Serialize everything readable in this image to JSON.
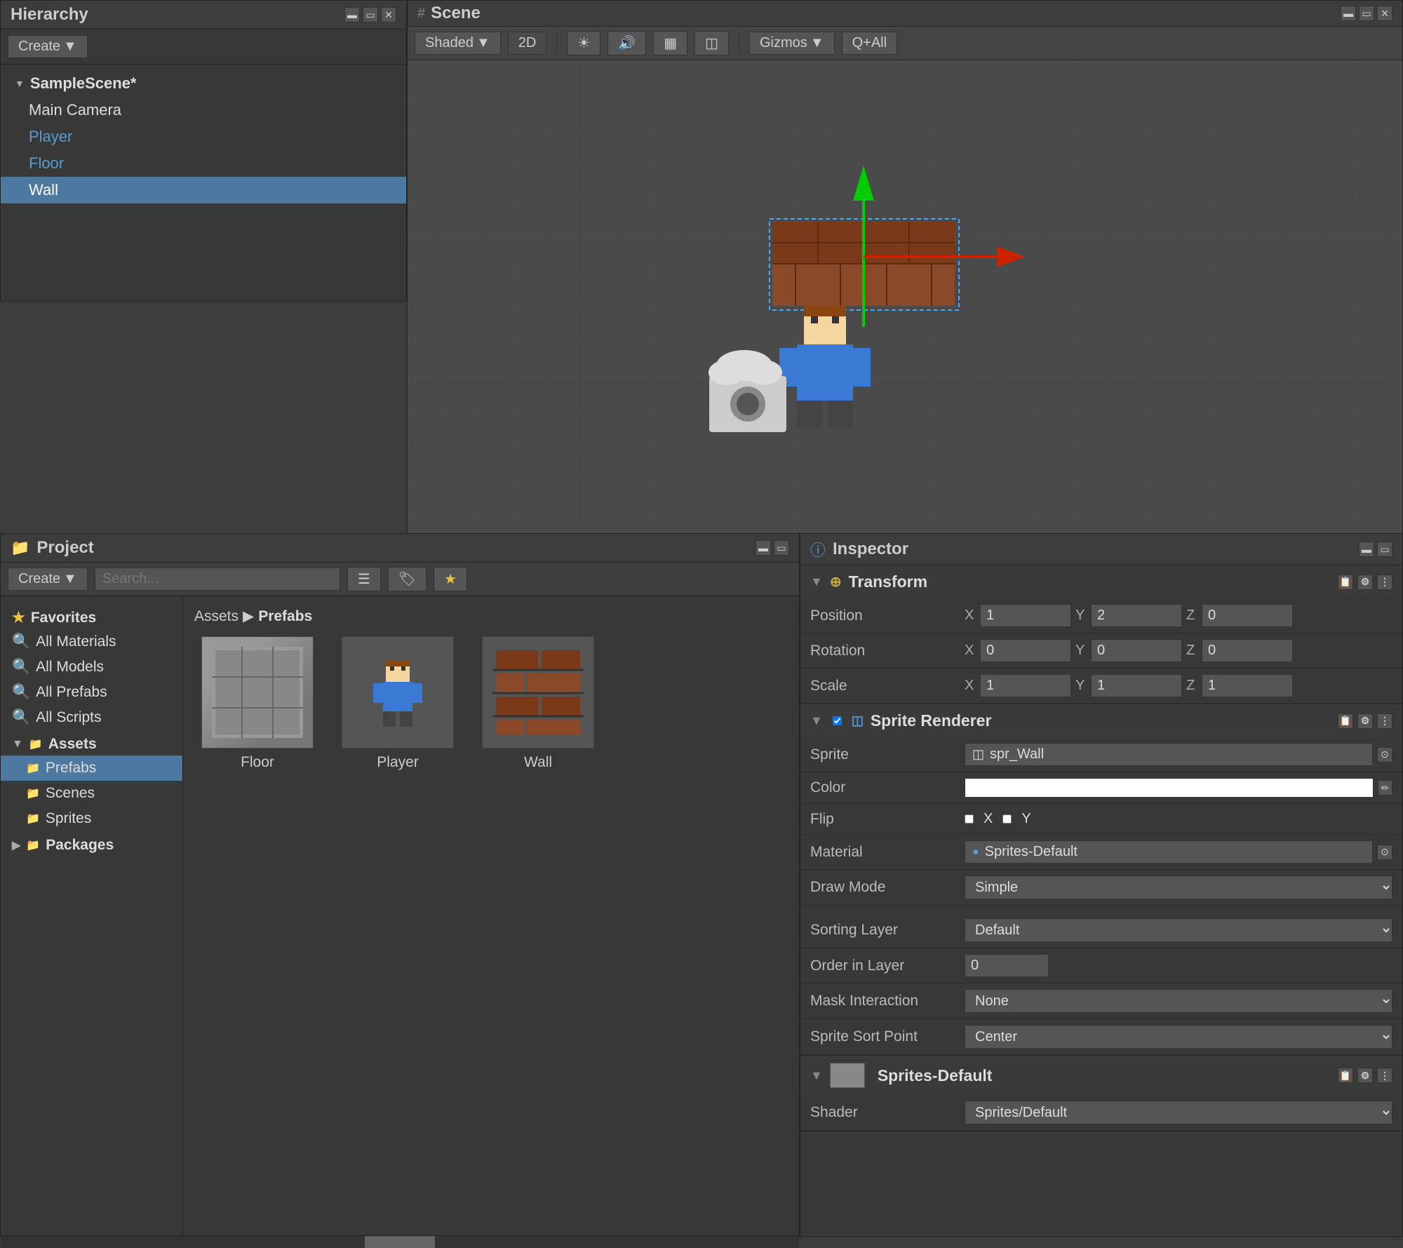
{
  "hierarchy": {
    "title": "Hierarchy",
    "create_label": "Create",
    "scene_name": "SampleScene*",
    "items": [
      {
        "label": "Main Camera",
        "indent": 1,
        "color": "white",
        "selected": false
      },
      {
        "label": "Player",
        "indent": 1,
        "color": "blue",
        "selected": false
      },
      {
        "label": "Floor",
        "indent": 1,
        "color": "blue",
        "selected": false
      },
      {
        "label": "Wall",
        "indent": 1,
        "color": "white",
        "selected": true
      }
    ]
  },
  "scene": {
    "title": "Scene",
    "shading_mode": "Shaded",
    "is_2d": true,
    "toolbar_items": [
      "Shaded",
      "2D",
      "☀",
      "🔊",
      "📷",
      "📊",
      "Gizmos",
      "Q+All"
    ]
  },
  "project": {
    "title": "Project",
    "create_label": "Create",
    "search_placeholder": "",
    "breadcrumb_path": "Assets",
    "breadcrumb_bold": "Prefabs",
    "sidebar": {
      "favorites_label": "Favorites",
      "items": [
        "All Materials",
        "All Models",
        "All Prefabs",
        "All Scripts"
      ],
      "assets_label": "Assets",
      "asset_folders": [
        "Prefabs",
        "Scenes",
        "Sprites"
      ],
      "packages_label": "Packages"
    },
    "assets": [
      {
        "name": "Floor",
        "type": "floor"
      },
      {
        "name": "Player",
        "type": "player"
      },
      {
        "name": "Wall",
        "type": "wall"
      }
    ]
  },
  "inspector": {
    "title": "Inspector",
    "transform": {
      "label": "Transform",
      "position": {
        "label": "Position",
        "x": "1",
        "y": "2",
        "z": "0"
      },
      "rotation": {
        "label": "Rotation",
        "x": "0",
        "y": "0",
        "z": "0"
      },
      "scale": {
        "label": "Scale",
        "x": "1",
        "y": "1",
        "z": "1"
      }
    },
    "sprite_renderer": {
      "label": "Sprite Renderer",
      "sprite_label": "Sprite",
      "sprite_value": "spr_Wall",
      "color_label": "Color",
      "flip_label": "Flip",
      "flip_x": "X",
      "flip_y": "Y",
      "material_label": "Material",
      "material_value": "Sprites-Default",
      "draw_mode_label": "Draw Mode",
      "draw_mode_value": "Simple",
      "sorting_layer_label": "Sorting Layer",
      "sorting_layer_value": "Default",
      "order_layer_label": "Order in Layer",
      "order_layer_value": "0",
      "mask_interaction_label": "Mask Interaction",
      "mask_interaction_value": "None",
      "sprite_sort_point_label": "Sprite Sort Point",
      "sprite_sort_point_value": "Center"
    },
    "material_section": {
      "name": "Sprites-Default",
      "shader_label": "Shader",
      "shader_value": "Sprites/Default"
    }
  }
}
